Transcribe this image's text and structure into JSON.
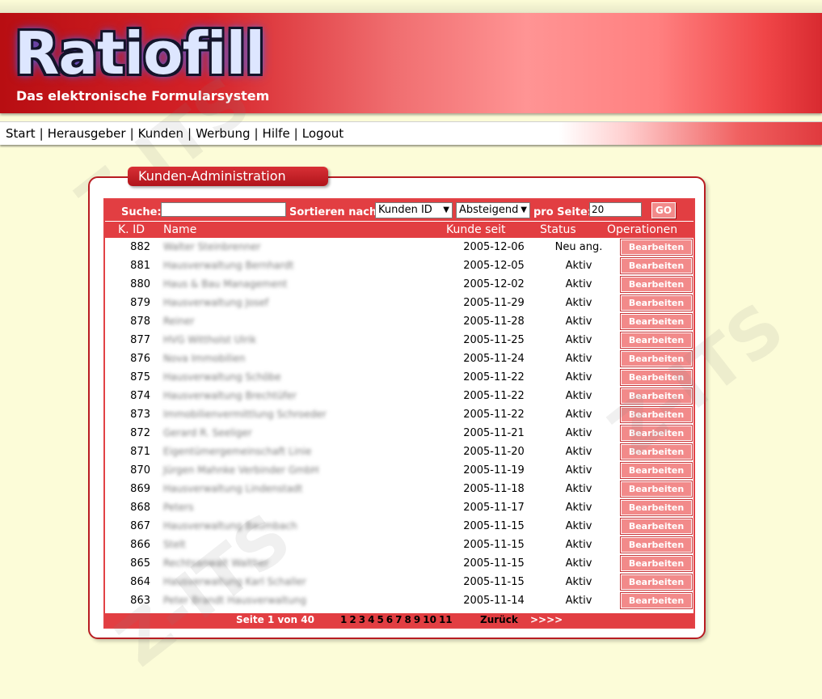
{
  "header": {
    "logo_text": "Ratiofill",
    "tagline": "Das elektronische Formularsystem"
  },
  "nav": {
    "items": [
      "Start",
      "Herausgeber",
      "Kunden",
      "Werbung",
      "Hilfe",
      "Logout"
    ]
  },
  "panel": {
    "title": "Kunden-Administration"
  },
  "search": {
    "label": "Suche:",
    "value": "",
    "sort_label": "Sortieren nach:",
    "sort_field": "Kunden ID",
    "sort_order": "Absteigend",
    "per_page_label": "pro Seite:",
    "per_page_value": "20",
    "go_label": "GO"
  },
  "table": {
    "columns": [
      "K. ID",
      "Name",
      "Kunde seit",
      "Status",
      "Operationen"
    ],
    "edit_label": "Bearbeiten",
    "rows": [
      {
        "id": "882",
        "name": "Walter Steinbrenner",
        "since": "2005-12-06",
        "status": "Neu ang."
      },
      {
        "id": "881",
        "name": "Hausverwaltung Bernhardt",
        "since": "2005-12-05",
        "status": "Aktiv"
      },
      {
        "id": "880",
        "name": "Haus & Bau Management",
        "since": "2005-12-02",
        "status": "Aktiv"
      },
      {
        "id": "879",
        "name": "Hausverwaltung Josef",
        "since": "2005-11-29",
        "status": "Aktiv"
      },
      {
        "id": "878",
        "name": "Reiner",
        "since": "2005-11-28",
        "status": "Aktiv"
      },
      {
        "id": "877",
        "name": "HVG Wittholst Ulrik",
        "since": "2005-11-25",
        "status": "Aktiv"
      },
      {
        "id": "876",
        "name": "Nova Immobilien",
        "since": "2005-11-24",
        "status": "Aktiv"
      },
      {
        "id": "875",
        "name": "Hausverwaltung Schöbe",
        "since": "2005-11-22",
        "status": "Aktiv"
      },
      {
        "id": "874",
        "name": "Hausverwaltung Brechtüfer",
        "since": "2005-11-22",
        "status": "Aktiv"
      },
      {
        "id": "873",
        "name": "Immobilienvermittlung Schroeder",
        "since": "2005-11-22",
        "status": "Aktiv"
      },
      {
        "id": "872",
        "name": "Gerard R. Seeliger",
        "since": "2005-11-21",
        "status": "Aktiv"
      },
      {
        "id": "871",
        "name": "Eigentümergemeinschaft Linie",
        "since": "2005-11-20",
        "status": "Aktiv"
      },
      {
        "id": "870",
        "name": "Jürgen Mahnke Verbinder GmbH",
        "since": "2005-11-19",
        "status": "Aktiv"
      },
      {
        "id": "869",
        "name": "Hausverwaltung Lindenstadt",
        "since": "2005-11-18",
        "status": "Aktiv"
      },
      {
        "id": "868",
        "name": "Peters",
        "since": "2005-11-17",
        "status": "Aktiv"
      },
      {
        "id": "867",
        "name": "Hausverwaltung Baumbach",
        "since": "2005-11-15",
        "status": "Aktiv"
      },
      {
        "id": "866",
        "name": "Stelt",
        "since": "2005-11-15",
        "status": "Aktiv"
      },
      {
        "id": "865",
        "name": "Rechtsanwalt Walther",
        "since": "2005-11-15",
        "status": "Aktiv"
      },
      {
        "id": "864",
        "name": "Hausverwaltung Karl Schaller",
        "since": "2005-11-15",
        "status": "Aktiv"
      },
      {
        "id": "863",
        "name": "Peter Brandt Hausverwaltung",
        "since": "2005-11-14",
        "status": "Aktiv"
      }
    ]
  },
  "pagination": {
    "status": "Seite 1 von 40",
    "pages": [
      "1",
      "2",
      "3",
      "4",
      "5",
      "6",
      "7",
      "8",
      "9",
      "10",
      "11"
    ],
    "back_label": "Zurück",
    "next_label": ">>>>"
  },
  "watermark": "Z-ITS"
}
